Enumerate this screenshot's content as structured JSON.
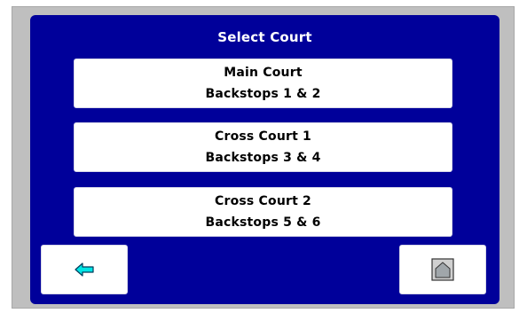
{
  "screen": {
    "title": "Select Court"
  },
  "courts": [
    {
      "name": "Main Court",
      "backstops": "Backstops 1 & 2"
    },
    {
      "name": "Cross Court 1",
      "backstops": "Backstops 3 & 4"
    },
    {
      "name": "Cross Court 2",
      "backstops": "Backstops 5 & 6"
    }
  ],
  "nav": {
    "back_icon": "left-arrow-icon",
    "home_icon": "home-icon"
  },
  "colors": {
    "screen_background": "#00009a",
    "button_background": "#ffffff",
    "bezel": "#bfbfbf",
    "back_arrow": "#00e5e5"
  }
}
